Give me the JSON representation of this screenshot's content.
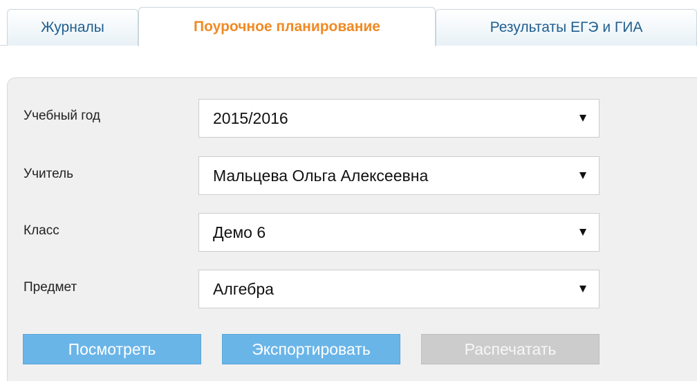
{
  "tabs": [
    {
      "label": "Журналы",
      "active": false
    },
    {
      "label": "Поурочное планирование",
      "active": true
    },
    {
      "label": "Результаты ЕГЭ и ГИА",
      "active": false
    }
  ],
  "form": {
    "fields": [
      {
        "label": "Учебный год",
        "value": "2015/2016"
      },
      {
        "label": "Учитель",
        "value": "Мальцева Ольга Алексеевна"
      },
      {
        "label": "Класс",
        "value": "Демо 6"
      },
      {
        "label": "Предмет",
        "value": "Алгебра"
      }
    ]
  },
  "buttons": {
    "view": "Посмотреть",
    "export": "Экспортировать",
    "print": "Распечатать"
  },
  "colors": {
    "active_tab": "#f08a24",
    "inactive_tab_text": "#1f5e8f",
    "button_primary": "#6ab5e8",
    "button_disabled": "#cccccc"
  }
}
